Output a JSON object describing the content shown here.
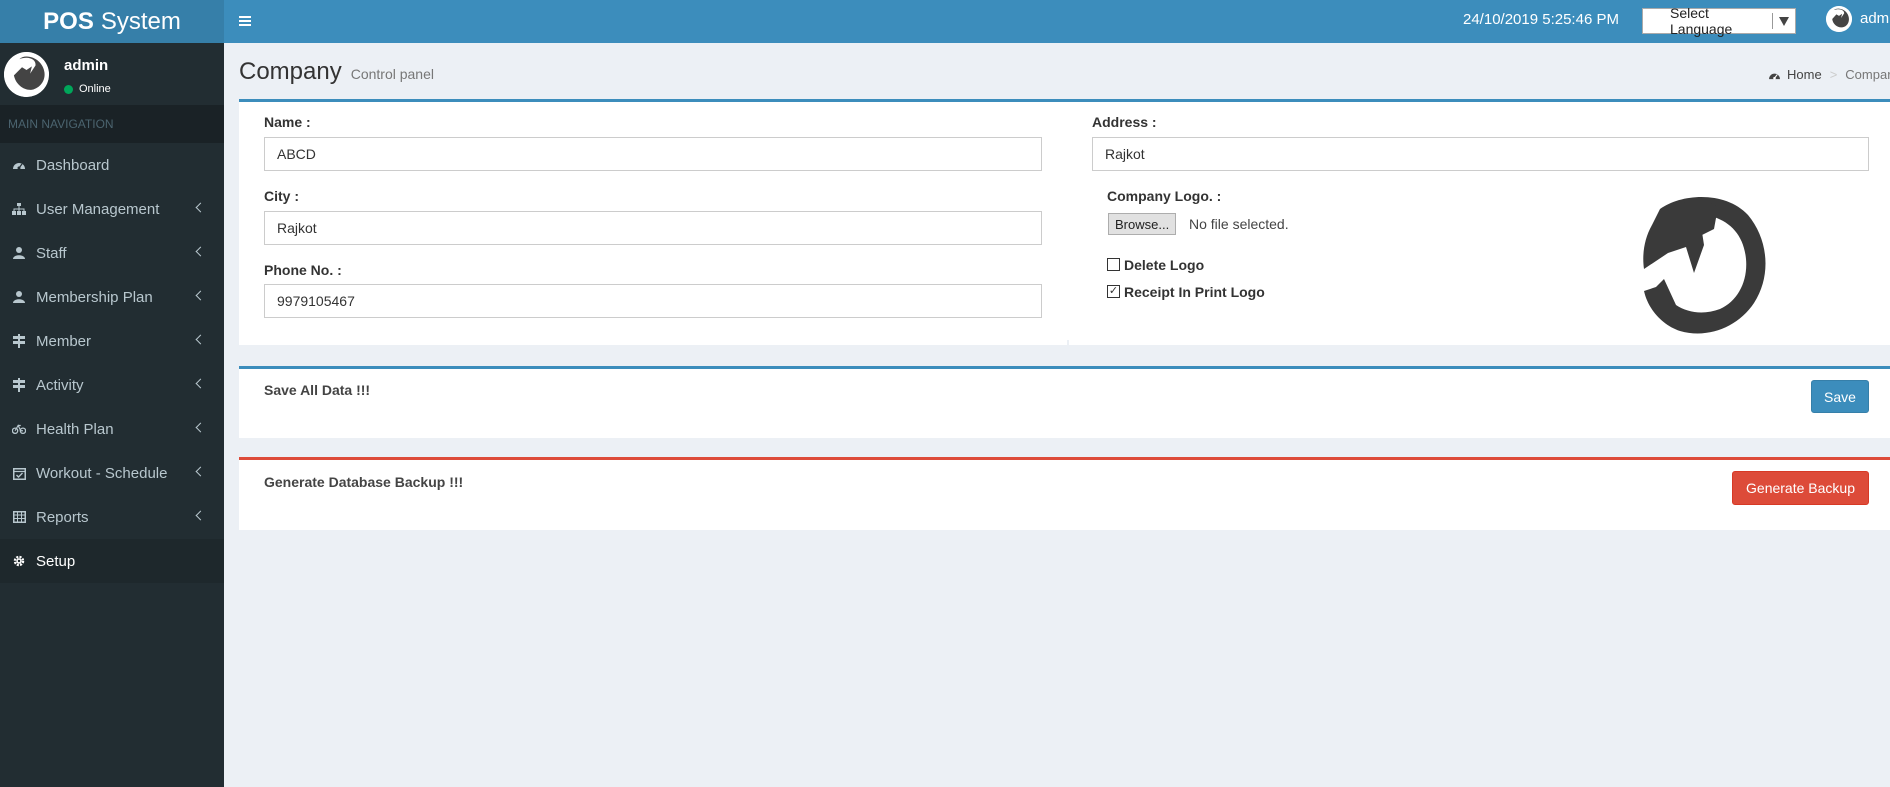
{
  "header": {
    "logo_bold": "POS",
    "logo_light": "System",
    "datetime": "24/10/2019 5:25:46 PM",
    "language_select": "Select Language",
    "user": "admin"
  },
  "sidebar": {
    "user_name": "admin",
    "status": "Online",
    "nav_header": "MAIN NAVIGATION",
    "items": [
      {
        "label": "Dashboard",
        "icon": "dashboard-icon"
      },
      {
        "label": "User Management",
        "icon": "sitemap-icon"
      },
      {
        "label": "Staff",
        "icon": "user-icon"
      },
      {
        "label": "Membership Plan",
        "icon": "user-icon"
      },
      {
        "label": "Member",
        "icon": "signpost-icon"
      },
      {
        "label": "Activity",
        "icon": "signpost-icon"
      },
      {
        "label": "Health Plan",
        "icon": "bicycle-icon"
      },
      {
        "label": "Workout - Schedule",
        "icon": "calendar-check-icon"
      },
      {
        "label": "Reports",
        "icon": "table-icon"
      },
      {
        "label": "Setup",
        "icon": "gear-icon"
      }
    ]
  },
  "page": {
    "title": "Company",
    "subtitle": "Control panel",
    "breadcrumb_home": "Home",
    "breadcrumb_current": "Compar"
  },
  "form": {
    "name_label": "Name :",
    "name_value": "ABCD",
    "city_label": "City :",
    "city_value": "Rajkot",
    "phone_label": "Phone No. :",
    "phone_value": "9979105467",
    "address_label": "Address :",
    "address_value": "Rajkot",
    "logo_label": "Company Logo. :",
    "browse_label": "Browse...",
    "file_status": "No file selected.",
    "delete_logo_label": "Delete Logo",
    "delete_logo_checked": false,
    "receipt_logo_label": "Receipt In Print Logo",
    "receipt_logo_checked": true
  },
  "save_box": {
    "title": "Save All Data !!!",
    "button": "Save"
  },
  "backup_box": {
    "title": "Generate Database Backup !!!",
    "button": "Generate Backup"
  },
  "colors": {
    "primary": "#3c8dbc",
    "danger": "#dd4b39",
    "sidebar": "#222d32"
  }
}
